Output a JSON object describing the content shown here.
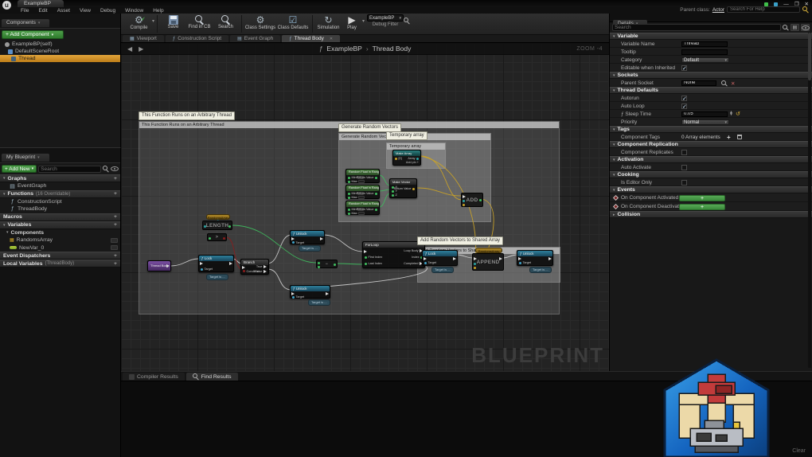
{
  "window": {
    "logo": "u",
    "tab": "ExampleBP",
    "menus": [
      "File",
      "Edit",
      "Asset",
      "View",
      "Debug",
      "Window",
      "Help"
    ],
    "minimize": "—",
    "restore": "❐",
    "close": "✕",
    "parent_class_label": "Parent class:",
    "parent_class_value": "Actor",
    "help_placeholder": "Search For Help"
  },
  "components": {
    "tab": "Components",
    "add_button": "+ Add Component",
    "caret": "▾",
    "items": [
      "ExampleBP(self)",
      "DefaultSceneRoot",
      "Thread"
    ]
  },
  "my_blueprint": {
    "tab": "My Blueprint",
    "add_new": "+ Add New",
    "caret": "▾",
    "search_placeholder": "Search",
    "plus": "+",
    "rows": {
      "graphs": "Graphs",
      "event_graph": "EventGraph",
      "functions": "Functions",
      "functions_hint": "(16 Overridable)",
      "construction_script": "ConstructionScript",
      "thread_body": "ThreadBody",
      "macros": "Macros",
      "variables": "Variables",
      "components": "Components",
      "randoms_array": "RandomsArray",
      "new_var": "NewVar_0",
      "event_dispatchers": "Event Dispatchers",
      "local_variables": "Local Variables",
      "local_variables_hint": "(ThreadBody)"
    }
  },
  "toolbar": {
    "compile": "Compile",
    "save": "Save",
    "find_in_cb": "Find in CB",
    "search": "Search",
    "class_settings": "Class Settings",
    "class_defaults": "Class Defaults",
    "simulation": "Simulation",
    "play": "Play",
    "debug_target": "ExampleBP",
    "debug_filter": "Debug Filter"
  },
  "tabs": {
    "viewport": "Viewport",
    "construction_script": "Construction Script",
    "event_graph": "Event Graph",
    "thread_body": "Thread Body"
  },
  "graph": {
    "fn_icon": "ƒ",
    "breadcrumb_root": "ExampleBP",
    "breadcrumb_sep": "›",
    "breadcrumb_current": "Thread Body",
    "back": "◀",
    "forward": "▶",
    "zoom": "ZOOM -4",
    "watermark": "BLUEPRINT",
    "comments": {
      "main": "This Function Runs on an Arbitrary Thread",
      "generate": "Generate Random Vectors",
      "temp": "Temporary array",
      "append": "Add Random Vectors to Shared Array"
    },
    "nodes": {
      "entry": "Thread Body",
      "lock": "ƒ Lock",
      "unlock": "ƒ Unlock",
      "target": "Target",
      "target_hint": "Target is ...",
      "branch": "Branch",
      "condition": "Condition",
      "true": "True",
      "false": "False",
      "randoms_array": "RandomsArray",
      "length": "LENGTH",
      "greater": ">",
      "minus": "−",
      "forloop": "ForLoop",
      "first_index": "First Index",
      "last_index": "Last Index",
      "loop_body": "Loop Body",
      "index": "Index",
      "completed": "Completed",
      "append": "APPEND",
      "add": "ADD",
      "random_float": "Random Float in Range",
      "min": "Min",
      "max": "Max",
      "return_value": "Return Value",
      "make_vector": "Make Vector",
      "x": "X",
      "y": "Y",
      "z": "Z",
      "make_array": "Make Array",
      "elem": "[0]",
      "array": "Array",
      "add_pin": "Add pin +"
    }
  },
  "details": {
    "tab": "Details",
    "search_placeholder": "Search",
    "variable": {
      "title": "Variable",
      "name_label": "Variable Name",
      "name_value": "Thread",
      "tooltip_label": "Tooltip",
      "category_label": "Category",
      "category_value": "Default",
      "editable_label": "Editable when Inherited"
    },
    "sockets": {
      "title": "Sockets",
      "parent_socket_label": "Parent Socket",
      "parent_socket_value": "None"
    },
    "thread_defaults": {
      "title": "Thread Defaults",
      "autorun": "Autorun",
      "auto_loop": "Auto Loop",
      "sleep_time": "ƒ Sleep Time",
      "sleep_value": "0.05",
      "priority": "Priority",
      "priority_value": "Normal"
    },
    "tags": {
      "title": "Tags",
      "component_tags": "Component Tags",
      "value": "0 Array elements"
    },
    "replication": {
      "title": "Component Replication",
      "row": "Component Replicates"
    },
    "activation": {
      "title": "Activation",
      "row": "Auto Activate"
    },
    "cooking": {
      "title": "Cooking",
      "row": "Is Editor Only"
    },
    "events": {
      "title": "Events",
      "activated": "On Component Activated",
      "deactivated": "On Component Deactivated",
      "plus": "+"
    },
    "collision": {
      "title": "Collision"
    },
    "check": "✓",
    "caret": "▾",
    "collapsed_caret": "▸"
  },
  "bottom": {
    "compiler_results": "Compiler Results",
    "find_results": "Find Results",
    "clear": "Clear"
  }
}
